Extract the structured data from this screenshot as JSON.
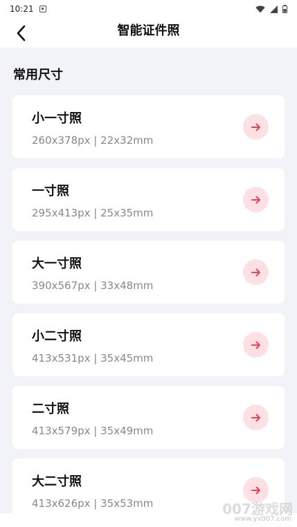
{
  "status_bar": {
    "time": "10:21"
  },
  "app_bar": {
    "title": "智能证件照"
  },
  "section": {
    "title": "常用尺寸"
  },
  "colors": {
    "accent": "#e8415a",
    "accent_bg": "#fde0e4",
    "page_bg": "#f2f3f8",
    "card_bg": "#ffffff",
    "spec_text": "#888888"
  },
  "sizes": [
    {
      "name": "小一寸照",
      "spec": "260x378px | 22x32mm",
      "icon": "arrow-right-icon"
    },
    {
      "name": "一寸照",
      "spec": "295x413px | 25x35mm",
      "icon": "arrow-right-icon"
    },
    {
      "name": "大一寸照",
      "spec": "390x567px | 33x48mm",
      "icon": "arrow-right-icon"
    },
    {
      "name": "小二寸照",
      "spec": "413x531px | 35x45mm",
      "icon": "arrow-right-icon"
    },
    {
      "name": "二寸照",
      "spec": "413x579px | 35x49mm",
      "icon": "arrow-right-icon"
    },
    {
      "name": "大二寸照",
      "spec": "413x626px | 35x53mm",
      "icon": "arrow-right-icon"
    }
  ],
  "watermark": {
    "text": "007游戏网",
    "url": "www.yx007.com"
  }
}
